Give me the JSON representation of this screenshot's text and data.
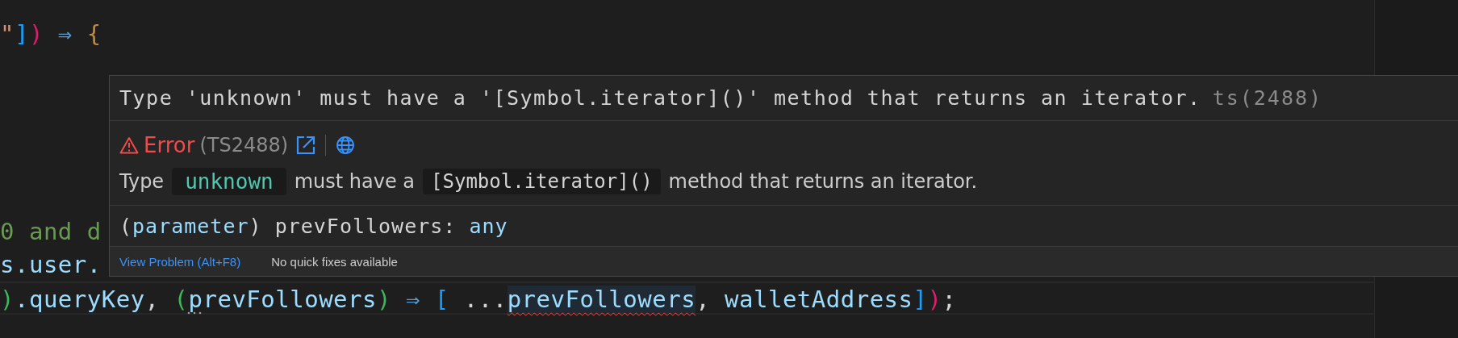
{
  "code_lines": [
    {
      "tokens": [
        {
          "text": "\"",
          "kind": "string"
        },
        {
          "text": "]",
          "kind": "bracket_blue"
        },
        {
          "text": ")",
          "kind": "bracket_pink"
        },
        {
          "text": " ⇒ ",
          "kind": "operator"
        },
        {
          "text": "{",
          "kind": "bracket_gold"
        }
      ]
    },
    {
      "tokens": [
        {
          "text": "0 and d",
          "kind": "comment"
        }
      ]
    },
    {
      "tokens": [
        {
          "text": "s.user.",
          "kind": "variable"
        }
      ]
    },
    {
      "tokens": [
        {
          "text": ")",
          "kind": "bracket_green"
        },
        {
          "text": ".queryKey",
          "kind": "variable"
        },
        {
          "text": ", ",
          "kind": "plain"
        },
        {
          "text": "(",
          "kind": "bracket_green"
        },
        {
          "text": "prevFollowers",
          "kind": "variable"
        },
        {
          "text": ")",
          "kind": "bracket_green"
        },
        {
          "text": " ⇒ ",
          "kind": "operator"
        },
        {
          "text": "[",
          "kind": "bracket_blue"
        },
        {
          "text": " ...",
          "kind": "plain"
        },
        {
          "text": "prevFollowers",
          "kind": "error_variable"
        },
        {
          "text": ", ",
          "kind": "plain"
        },
        {
          "text": "walletAddress",
          "kind": "variable"
        },
        {
          "text": "]",
          "kind": "bracket_blue"
        },
        {
          "text": ")",
          "kind": "bracket_pink"
        },
        {
          "text": ";",
          "kind": "plain"
        }
      ]
    }
  ],
  "hover": {
    "message": "Type 'unknown' must have a '[Symbol.iterator]()' method that returns an iterator.",
    "source": "ts(2488)",
    "severity": "Error",
    "code": "(TS2488)",
    "detail": [
      {
        "text": "Type",
        "kind": "text"
      },
      {
        "text": "unknown",
        "kind": "type"
      },
      {
        "text": "must have a",
        "kind": "text"
      },
      {
        "text": "[Symbol.iterator]()",
        "kind": "code"
      },
      {
        "text": "method that returns an iterator.",
        "kind": "text"
      }
    ],
    "signature": [
      {
        "text": "(",
        "kind": "plain"
      },
      {
        "text": "parameter",
        "kind": "keyword"
      },
      {
        "text": ") prevFollowers: ",
        "kind": "plain"
      },
      {
        "text": "any",
        "kind": "keyword"
      }
    ],
    "status": {
      "link": "View Problem (Alt+F8)",
      "note": "No quick fixes available"
    }
  }
}
